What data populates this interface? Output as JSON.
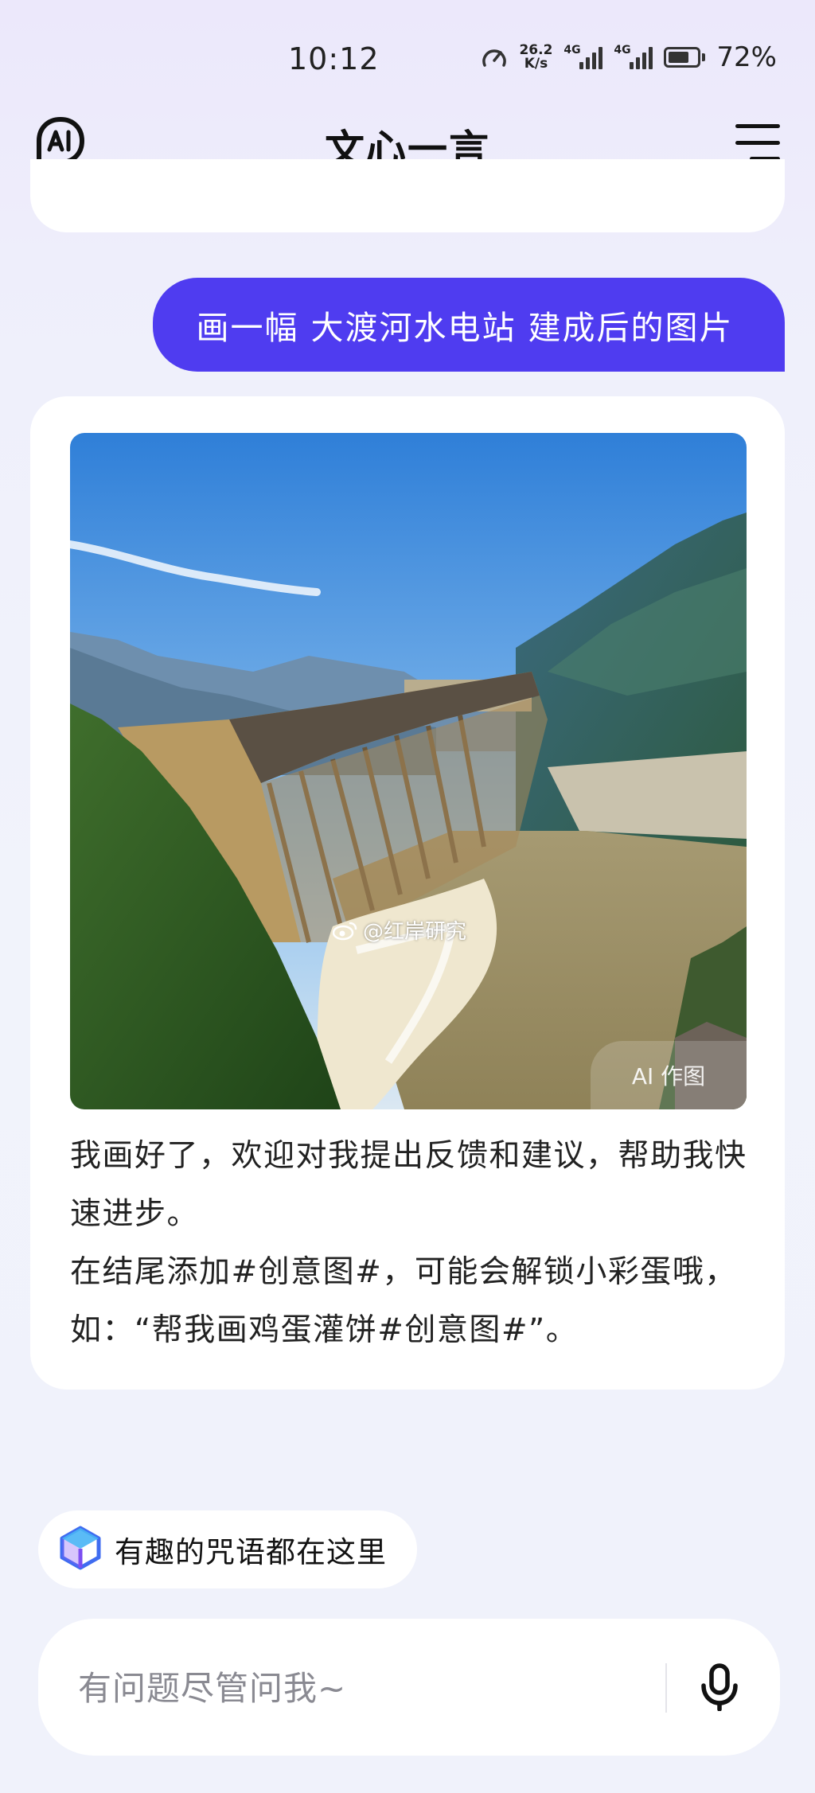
{
  "status_bar": {
    "time": "10:12",
    "net_speed_value": "26.2",
    "net_speed_unit": "K/s",
    "signal1_tag": "4G",
    "signal2_tag": "4G",
    "battery_percent_text": "72%",
    "battery_level": 0.72
  },
  "header": {
    "title": "文心一言",
    "logo_icon": "ai-logo-icon",
    "menu_icon": "menu-icon"
  },
  "conversation": {
    "user_message": "画一幅 大渡河水电站 建成后的图片",
    "response": {
      "image_watermark": "@红岸研究",
      "image_badge": "AI 作图",
      "text_lines": [
        "我画好了，欢迎对我提出反馈和建议，帮助我快速进步。",
        "在结尾添加#创意图#，可能会解锁小彩蛋哦，如：“帮我画鸡蛋灌饼#创意图#”。"
      ]
    }
  },
  "prompt_chip": {
    "label": "有趣的咒语都在这里",
    "icon": "cube-icon"
  },
  "input": {
    "placeholder": "有问题尽管问我~",
    "value": "",
    "mic_icon": "microphone-icon"
  },
  "colors": {
    "accent": "#4f3cf0",
    "background": "#eff0fb",
    "card": "#ffffff"
  }
}
